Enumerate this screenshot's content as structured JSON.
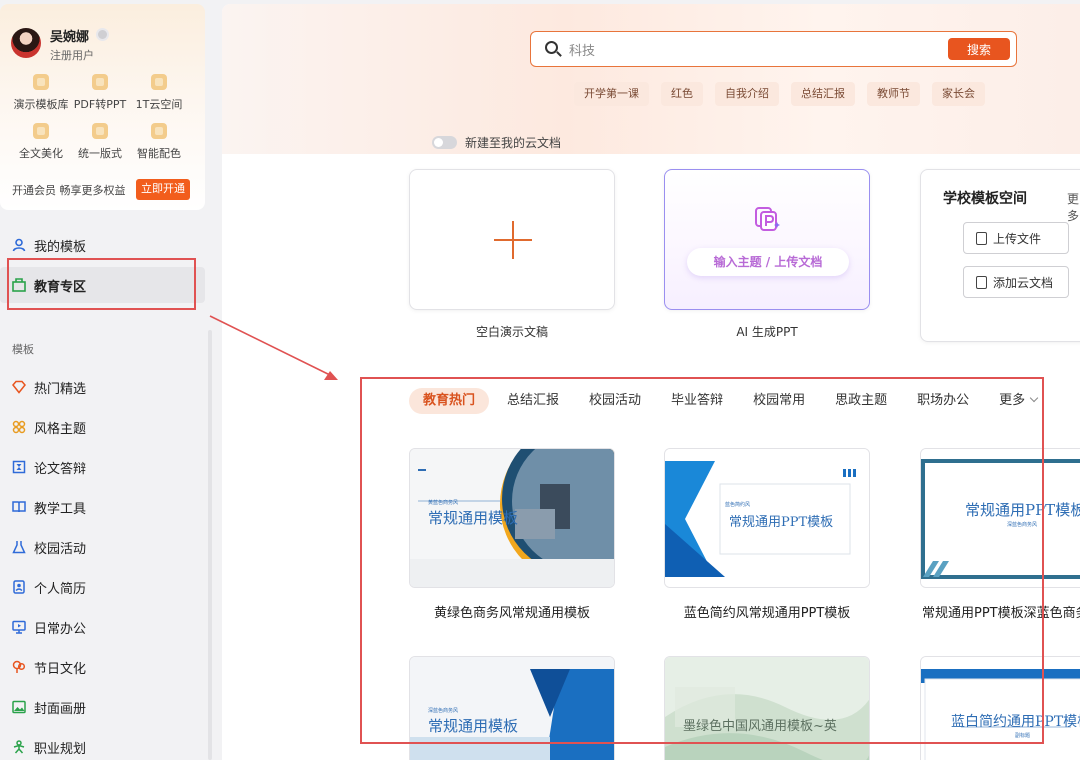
{
  "user": {
    "name": "吴婉娜",
    "role": "注册用户"
  },
  "features": [
    {
      "label": "演示模板库",
      "icon": "template-library-icon"
    },
    {
      "label": "PDF转PPT",
      "icon": "pdf-convert-icon"
    },
    {
      "label": "1T云空间",
      "icon": "cloud-space-icon"
    },
    {
      "label": "全文美化",
      "icon": "beautify-icon"
    },
    {
      "label": "统一版式",
      "icon": "layout-icon"
    },
    {
      "label": "智能配色",
      "icon": "palette-icon"
    }
  ],
  "vip": {
    "text": "开通会员 畅享更多权益",
    "button": "立即开通"
  },
  "nav_top": [
    {
      "label": "我的模板",
      "icon": "user-icon"
    },
    {
      "label": "教育专区",
      "icon": "education-icon",
      "active": true
    }
  ],
  "section_label": "模板",
  "nav_templates": [
    {
      "label": "热门精选",
      "icon": "diamond-icon"
    },
    {
      "label": "风格主题",
      "icon": "grid-icon"
    },
    {
      "label": "论文答辩",
      "icon": "hourglass-icon"
    },
    {
      "label": "教学工具",
      "icon": "book-icon"
    },
    {
      "label": "校园活动",
      "icon": "flask-icon"
    },
    {
      "label": "个人简历",
      "icon": "resume-icon"
    },
    {
      "label": "日常办公",
      "icon": "monitor-icon"
    },
    {
      "label": "节日文化",
      "icon": "festival-icon"
    },
    {
      "label": "封面画册",
      "icon": "image-icon"
    },
    {
      "label": "职业规划",
      "icon": "career-icon"
    }
  ],
  "search": {
    "value": "科技",
    "button": "搜索"
  },
  "tags": [
    "开学第一课",
    "红色",
    "自我介绍",
    "总结汇报",
    "教师节",
    "家长会"
  ],
  "toggle_label": "新建至我的云文档",
  "create_cards": {
    "blank": "空白演示文稿",
    "ai_pill": "输入主题 / 上传文档",
    "ai": "AI 生成PPT"
  },
  "school": {
    "title": "学校模板空间",
    "more": "更多",
    "upload": "上传文件",
    "add_cloud": "添加云文档"
  },
  "category_tabs": [
    "教育热门",
    "总结汇报",
    "校园活动",
    "毕业答辩",
    "校园常用",
    "思政主题",
    "职场办公",
    "更多"
  ],
  "templates": [
    {
      "caption": "黄绿色商务风常规通用模板",
      "title": "常规通用模板",
      "subtitle": "黄蓝色商务风"
    },
    {
      "caption": "蓝色简约风常规通用PPT模板",
      "title": "常规通用PPT模板",
      "subtitle": "蓝色简约风"
    },
    {
      "caption": "常规通用PPT模板深蓝色商务",
      "title": "常规通用PPT模板",
      "subtitle": "深蓝色商务风"
    },
    {
      "caption": "",
      "title": "常规通用模板",
      "subtitle": "深蓝色商务风"
    },
    {
      "caption": "",
      "title": "墨绿色中国风通用模板~英",
      "subtitle": ""
    },
    {
      "caption": "",
      "title": "蓝白简约通用PPT模板",
      "subtitle": "副标题"
    }
  ],
  "colors": {
    "accent": "#e8551f",
    "highlight_box": "#e05252",
    "primary_blue": "#2e6db4"
  }
}
